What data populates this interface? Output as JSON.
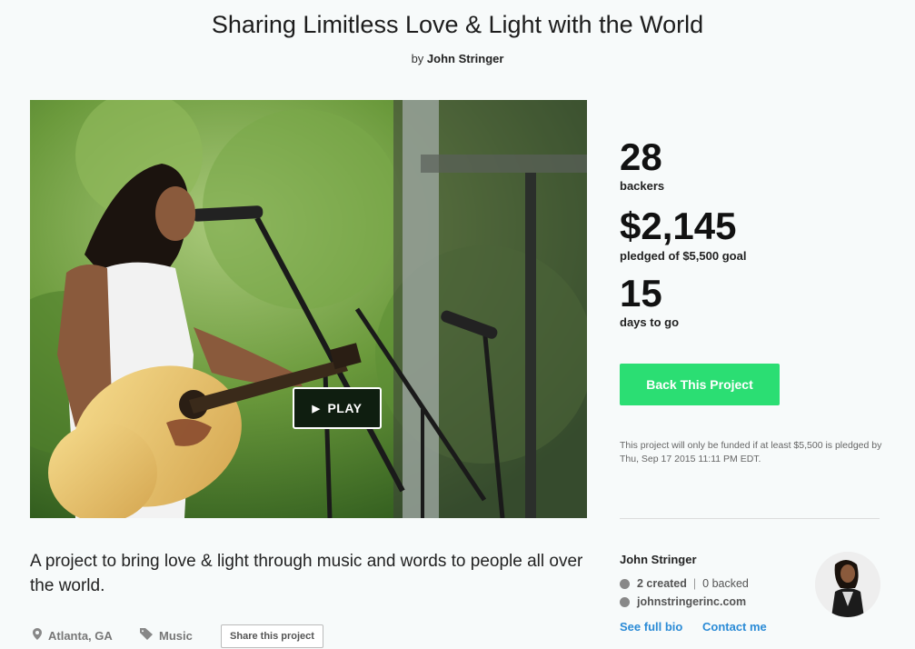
{
  "header": {
    "title": "Sharing Limitless Love & Light with the World",
    "by_prefix": "by",
    "creator": "John Stringer"
  },
  "video": {
    "play_label": "PLAY",
    "play_icon": "play-triangle-icon"
  },
  "stats": {
    "backers_count": "28",
    "backers_label": "backers",
    "pledged_amount": "$2,145",
    "pledged_label": "pledged of $5,500 goal",
    "days_count": "15",
    "days_label": "days to go"
  },
  "cta": {
    "back_label": "Back This Project",
    "funding_note": "This project will only be funded if at least $5,500 is pledged by Thu, Sep 17 2015 11:11 PM EDT."
  },
  "description": {
    "blurb": "A project to bring love & light through music and words to people all over the world.",
    "location": "Atlanta, GA",
    "category": "Music",
    "share_label": "Share this project"
  },
  "creator": {
    "name": "John Stringer",
    "created": "2 created",
    "backed": "0 backed",
    "website": "johnstringerinc.com",
    "bio_link": "See full bio",
    "contact_link": "Contact me"
  },
  "colors": {
    "cta_green": "#2bde73",
    "link_blue": "#2b8bd6",
    "background": "#f7fafa"
  }
}
